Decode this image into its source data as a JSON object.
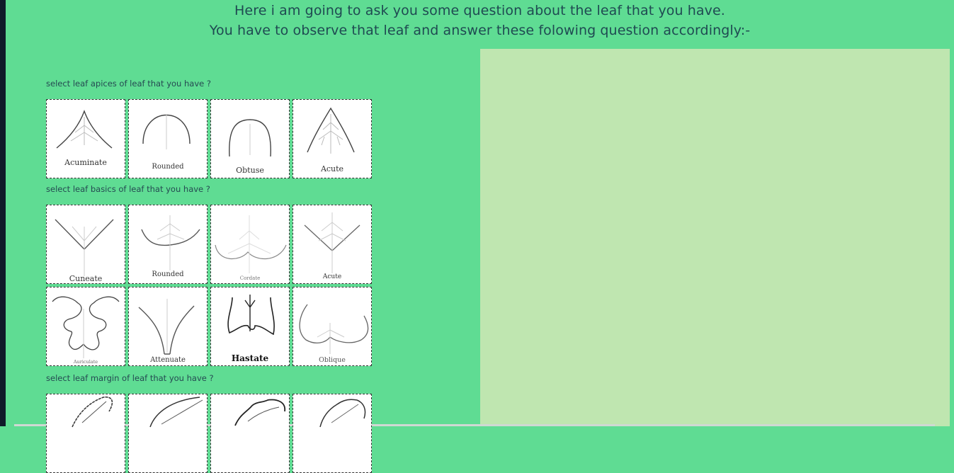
{
  "header": {
    "line1": "Here i am going to ask you some question about the leaf that you have.",
    "line2": "You have to observe that leaf and answer these folowing question accordingly:-"
  },
  "questions": {
    "apices": {
      "label": "select leaf apices of leaf that you have ?",
      "options": [
        "Acuminate",
        "Rounded",
        "Obtuse",
        "Acute"
      ]
    },
    "basics": {
      "label": "select leaf basics of leaf that you have ?",
      "options": [
        "Cuneate",
        "Rounded",
        "Cordate",
        "Acute",
        "Auriculate",
        "Attenuate",
        "Hastate",
        "Oblique"
      ]
    },
    "margin": {
      "label": "select leaf margin of leaf that you have ?"
    }
  },
  "colors": {
    "background": "#5fdc93",
    "panel": "#bfe6b0",
    "text": "#1f4a52"
  }
}
